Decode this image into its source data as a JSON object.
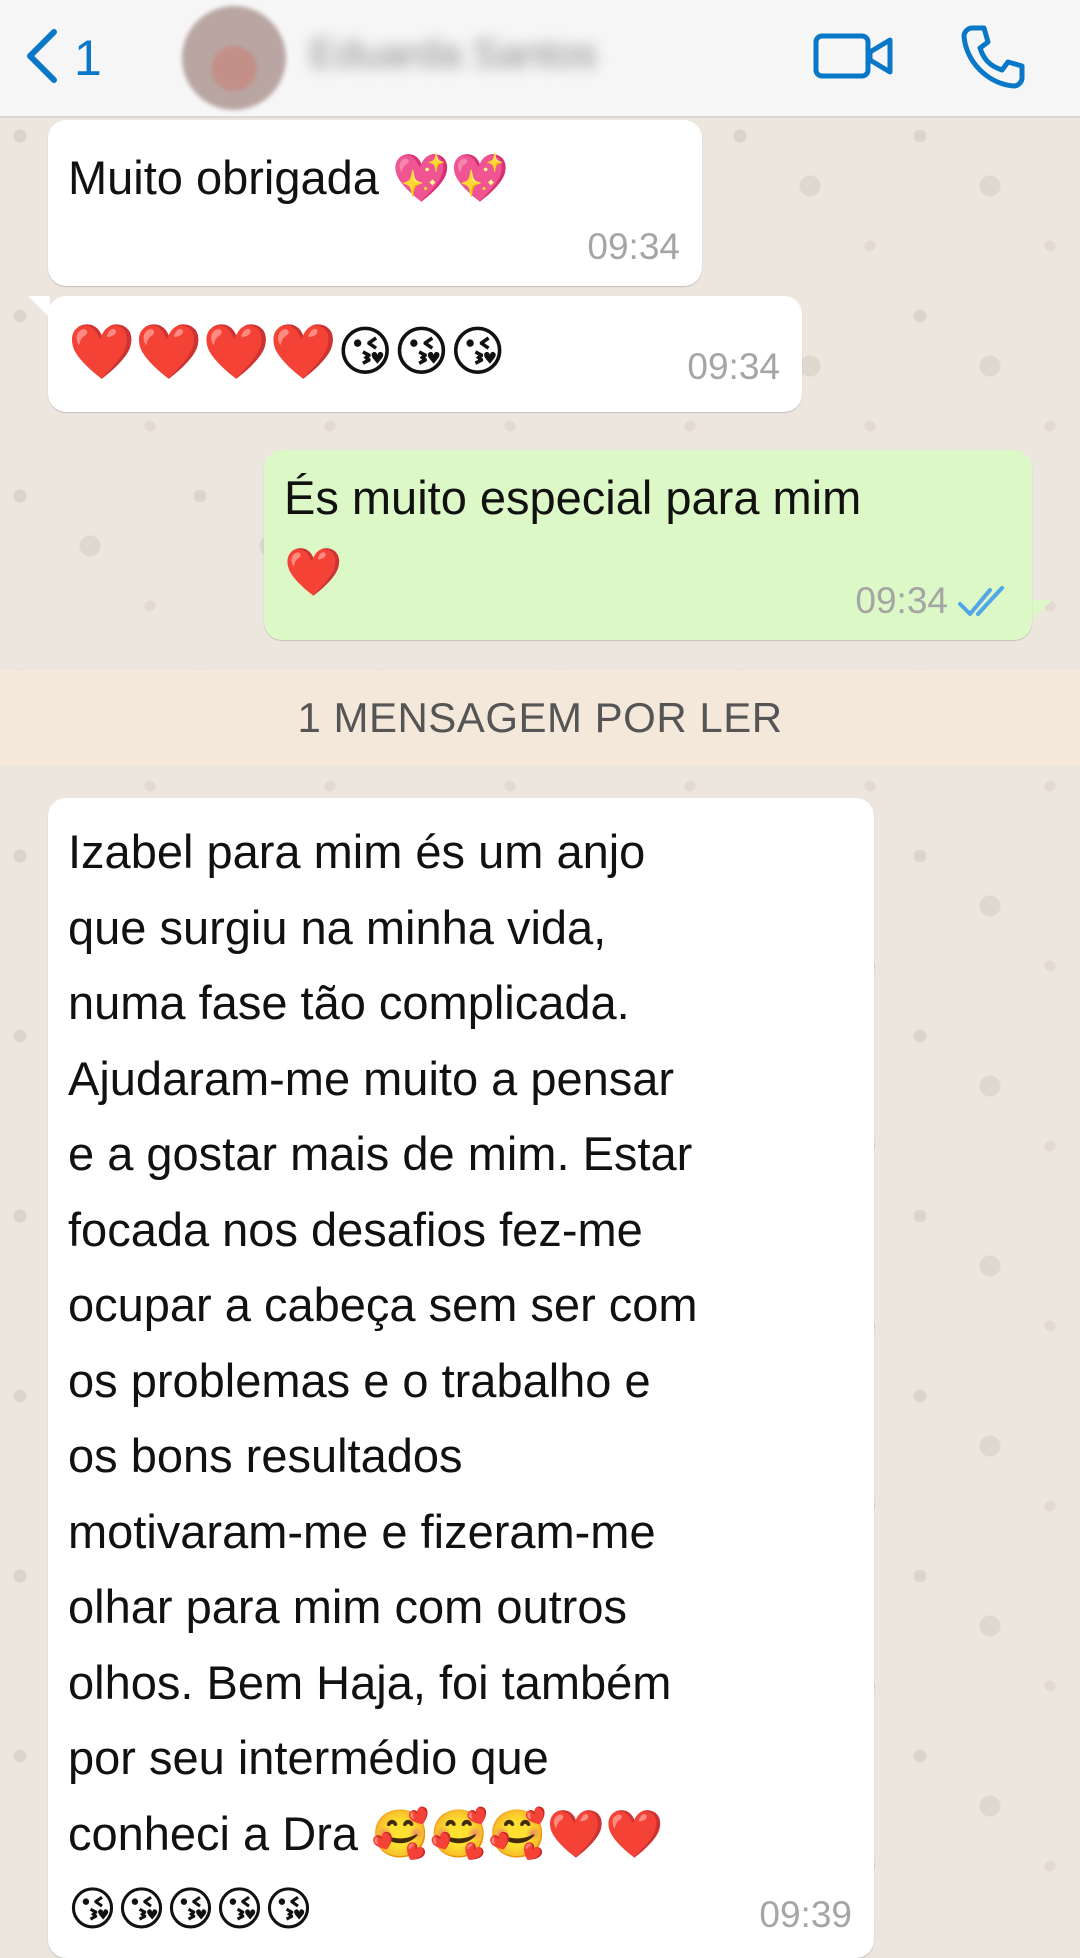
{
  "header": {
    "back_count": "1",
    "contact_name": "Eduarda Santos",
    "accent_color": "#0a78c8",
    "icons": [
      "chevron-left-icon",
      "video-camera-icon",
      "phone-icon"
    ]
  },
  "messages": [
    {
      "direction": "incoming",
      "text": "Muito obrigada",
      "emoji": "💖💖",
      "time": "09:34"
    },
    {
      "direction": "incoming",
      "text": "",
      "emoji": "❤️❤️❤️❤️😘😘😘",
      "time": "09:34"
    },
    {
      "direction": "outgoing",
      "text": "És muito especial para mim",
      "emoji": "❤️",
      "time": "09:34",
      "status": "read"
    }
  ],
  "unread_banner": "1 MENSAGEM POR LER",
  "long_message": {
    "direction": "incoming",
    "lines": [
      "Izabel para mim és um anjo",
      "que surgiu na minha vida,",
      "numa fase tão complicada.",
      "Ajudaram-me muito a pensar",
      "e a gostar mais de mim. Estar",
      "focada nos desafios fez-me",
      "ocupar a cabeça sem ser com",
      "os problemas e o trabalho e",
      "os bons resultados",
      "motivaram-me e fizeram-me",
      "olhar para mim com outros",
      "olhos. Bem Haja, foi também",
      "por seu intermédio que",
      "conheci a Dra"
    ],
    "line14_emoji": "🥰🥰🥰❤️❤️",
    "line15_emoji": "😘😘😘😘😘",
    "time": "09:39"
  }
}
